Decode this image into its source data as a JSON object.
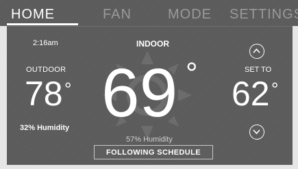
{
  "tabs": [
    {
      "label": "HOME",
      "active": true
    },
    {
      "label": "FAN",
      "active": false
    },
    {
      "label": "MODE",
      "active": false
    },
    {
      "label": "SETTINGS",
      "active": false
    }
  ],
  "status": {
    "time": "2:16am"
  },
  "outdoor": {
    "label": "OUTDOOR",
    "temperature": "78",
    "degree_symbol": "°",
    "humidity": "32% Humidity"
  },
  "indoor": {
    "label": "INDOOR",
    "temperature": "69",
    "degree_symbol": "°",
    "humidity": "57% Humidity"
  },
  "setpoint": {
    "label": "SET TO",
    "temperature": "62",
    "degree_symbol": "°",
    "up_icon": "chevron-up-icon",
    "down_icon": "chevron-down-icon"
  },
  "schedule_button": {
    "label": "FOLLOWING SCHEDULE"
  },
  "colors": {
    "screen_background": "#5b5b5b",
    "text": "#ffffff",
    "inactive_tab": "#9a9a9a",
    "frame": "#e6e6e6"
  }
}
